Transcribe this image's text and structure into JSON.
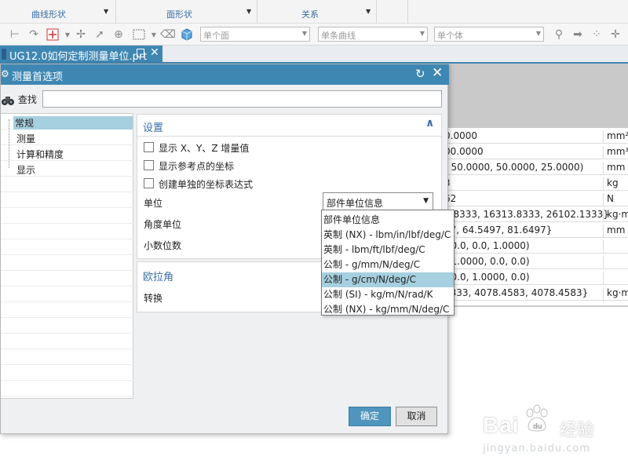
{
  "ribbon": {
    "groups": [
      {
        "label": "曲线形状"
      },
      {
        "label": "面形状"
      },
      {
        "label": "关系"
      }
    ]
  },
  "toolbar": {
    "face_filter": "单个面",
    "curve_filter": "单条曲线",
    "body_filter": "单个体"
  },
  "document_tab": {
    "title": "UG12.0如何定制测量单位.prt"
  },
  "info_table": {
    "rows": [
      {
        "value": "0.0000",
        "unit": "mm²"
      },
      {
        "value": "00.0000",
        "unit": "mm³"
      },
      {
        "value": "( 50.0000, 50.0000, 25.0000)",
        "unit": "mm"
      },
      {
        "value": "3",
        "unit": "kg"
      },
      {
        "value": "62",
        "unit": "N"
      },
      {
        "value": "3.8333, 16313.8333, 26102.1333}",
        "unit": "kg·m"
      },
      {
        "value": "97, 64.5497, 81.6497}",
        "unit": "mm"
      },
      {
        "value": "( 0.0, 0.0, 1.0000)",
        "unit": ""
      },
      {
        "value": "( 1.0000, 0.0, 0.0)",
        "unit": ""
      },
      {
        "value": "( 0.0, 1.0000, 0.0)",
        "unit": ""
      },
      {
        "value": "5333, 4078.4583, 4078.4583}",
        "unit": "kg·m"
      }
    ]
  },
  "dialog": {
    "title": "测量首选项",
    "find_label": "查找",
    "find_value": "",
    "tree": [
      {
        "label": "常规",
        "selected": true
      },
      {
        "label": "测量",
        "selected": false
      },
      {
        "label": "计算和精度",
        "selected": false
      },
      {
        "label": "显示",
        "selected": false
      }
    ],
    "settings": {
      "title": "设置",
      "checkboxes": [
        {
          "label": "显示 X、Y、Z 增量值",
          "checked": false
        },
        {
          "label": "显示参考点的坐标",
          "checked": false
        },
        {
          "label": "创建单独的坐标表达式",
          "checked": false
        }
      ],
      "unit_label": "单位",
      "unit_value": "部件单位信息",
      "angle_unit_label": "角度单位",
      "decimal_label": "小数位数"
    },
    "euler": {
      "title": "欧拉角",
      "transform_label": "转换"
    },
    "ok_label": "确定",
    "cancel_label": "取消"
  },
  "unit_dropdown": {
    "items": [
      {
        "label": "部件单位信息",
        "highlighted": false
      },
      {
        "label": "英制 (NX) - lbm/in/lbf/deg/C",
        "highlighted": false
      },
      {
        "label": "英制 - lbm/ft/lbf/deg/C",
        "highlighted": false
      },
      {
        "label": "公制 - g/mm/N/deg/C",
        "highlighted": false
      },
      {
        "label": "公制 - g/cm/N/deg/C",
        "highlighted": true
      },
      {
        "label": "公制 (SI) - kg/m/N/rad/K",
        "highlighted": false
      },
      {
        "label": "公制 (NX) - kg/mm/N/deg/C",
        "highlighted": false
      }
    ]
  },
  "watermark": {
    "brand": "Bai",
    "brand_suffix": "经验",
    "url": "jingyan.baidu.com"
  },
  "colors": {
    "accent_blue": "#3f87b3",
    "selection": "#a6cfdf",
    "ok_button": "#4f95be"
  }
}
